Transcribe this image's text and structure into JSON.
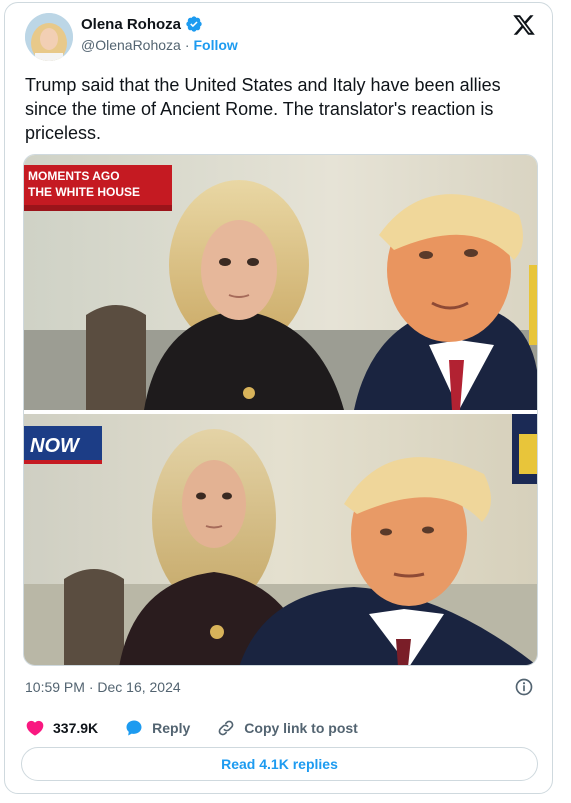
{
  "author": {
    "name": "Olena Rohoza",
    "handle": "@OlenaRohoza",
    "separator": "·",
    "follow_label": "Follow"
  },
  "tweet": {
    "text": "Trump said that the United States and Italy have been allies since the time of Ancient Rome. The translator's reaction is priceless."
  },
  "media": {
    "top_banner_line1": "MOMENTS AGO",
    "top_banner_line2": "THE WHITE HOUSE",
    "bottom_logo": "NOW"
  },
  "meta": {
    "timestamp": "10:59 PM · Dec 16, 2024"
  },
  "actions": {
    "likes": "337.9K",
    "reply_label": "Reply",
    "copy_label": "Copy link to post"
  },
  "read_replies_label": "Read 4.1K replies",
  "colors": {
    "accent": "#1d9bf0",
    "like": "#f91880",
    "text": "#0f1419",
    "muted": "#536471",
    "border": "#cfd9de"
  },
  "icons": [
    "x-logo-icon",
    "verified-badge-icon",
    "heart-icon",
    "reply-bubble-icon",
    "link-icon",
    "info-icon"
  ]
}
